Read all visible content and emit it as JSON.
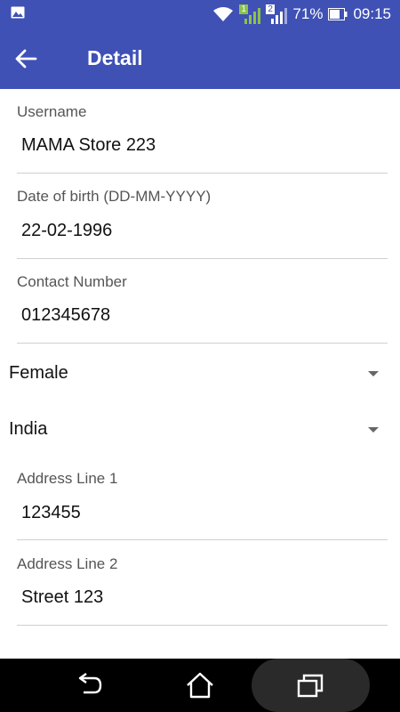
{
  "statusbar": {
    "battery": "71%",
    "time": "09:15",
    "sim1": "1",
    "sim2": "2"
  },
  "appbar": {
    "title": "Detail"
  },
  "form": {
    "username": {
      "label": "Username",
      "value": "MAMA Store 223"
    },
    "dob": {
      "label": "Date of birth (DD-MM-YYYY)",
      "value": "22-02-1996"
    },
    "contact": {
      "label": "Contact Number",
      "value": "012345678"
    },
    "gender": {
      "value": "Female"
    },
    "country": {
      "value": "India"
    },
    "address1": {
      "label": "Address Line 1",
      "value": "123455"
    },
    "address2": {
      "label": "Address Line 2",
      "value": "Street 123"
    }
  },
  "colors": {
    "primary": "#3f51b5",
    "navbar": "#000000"
  }
}
